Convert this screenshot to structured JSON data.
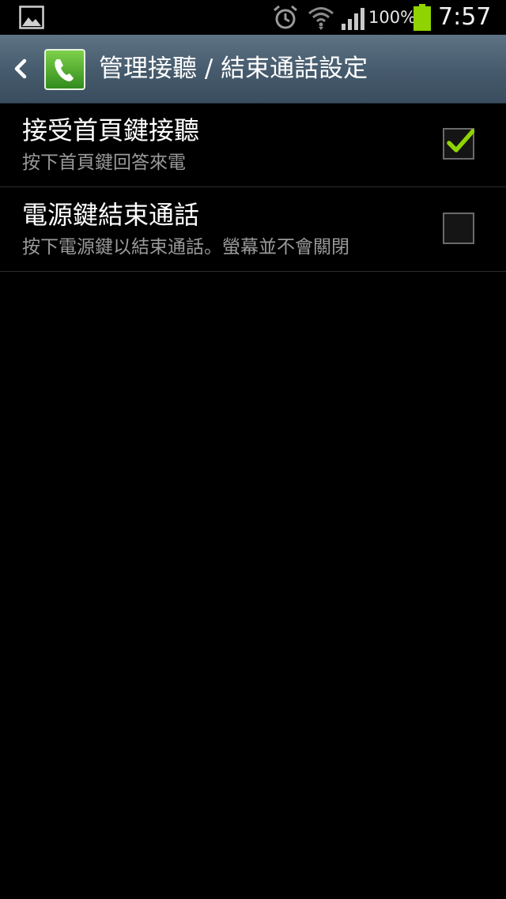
{
  "status_bar": {
    "icons": [
      "gallery-icon",
      "alarm-icon",
      "wifi-icon",
      "signal-icon",
      "battery-icon"
    ],
    "battery_level_text": "100%",
    "battery_level": 1.0,
    "time": "7:57"
  },
  "action_bar": {
    "back_icon": "chevron-left-icon",
    "app_icon": "phone-icon",
    "title": "管理接聽 / 結束通話設定"
  },
  "settings": {
    "items": [
      {
        "title": "接受首頁鍵接聽",
        "summary": "按下首頁鍵回答來電",
        "checked": true
      },
      {
        "title": "電源鍵結束通話",
        "summary": "按下電源鍵以結束通話。螢幕並不會關閉",
        "checked": false
      }
    ]
  },
  "colors": {
    "accent_check": "#8fd400",
    "battery": "#8fd400",
    "action_bar_top": "#5e7485",
    "action_bar_bottom": "#394d5e",
    "app_icon_green": "#4aa82c"
  }
}
